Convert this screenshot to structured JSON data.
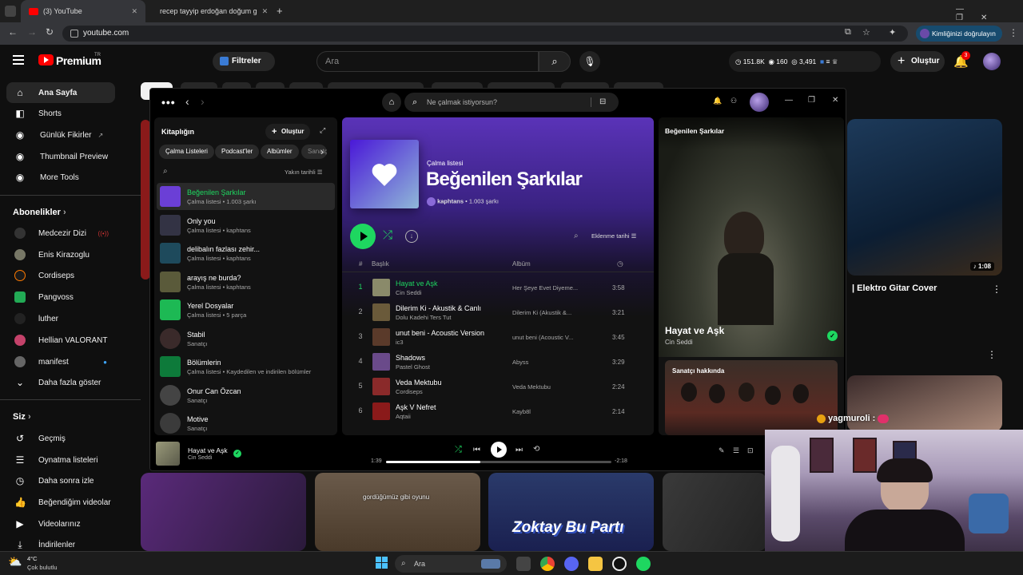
{
  "browser": {
    "tabs": [
      {
        "title": "(3) YouTube",
        "close": "✕"
      },
      {
        "title": "recep tayyip erdoğan doğum g",
        "close": "✕"
      }
    ],
    "new_tab": "+",
    "url": "youtube.com",
    "profile_pill": "Kimliğinizi doğrulayın",
    "window_controls": [
      "—",
      "❐",
      "✕"
    ]
  },
  "youtube": {
    "logo": "Premium",
    "region": "TR",
    "filters_label": "Filtreler",
    "search_placeholder": "Ara",
    "stats": [
      "151.8K",
      "160",
      "3,491"
    ],
    "create_label": "Oluştur",
    "notif_count": "3",
    "sidebar": {
      "main": [
        "Ana Sayfa",
        "Shorts",
        "Günlük Fikirler",
        "Thumbnail Preview",
        "More Tools"
      ],
      "subs_title": "Abonelikler",
      "subs": [
        "Medcezir Dizi",
        "Enis Kirazoglu",
        "Cordiseps",
        "Pangvoss",
        "luther",
        "Hellian VALORANT",
        "manifest"
      ],
      "more": "Daha fazla göster",
      "you_title": "Siz",
      "you": [
        "Geçmiş",
        "Oynatma listeleri",
        "Daha sonra izle",
        "Beğendiğim videolar",
        "Videolarınız",
        "İndirilenler"
      ]
    },
    "feed": {
      "video_title": "| Elektro Gitar Cover",
      "duration": "1:08",
      "subtitle_text": "gordüğümüz gibi oyunu",
      "thumb_text": "Zoktay Bu Partı"
    }
  },
  "spotify": {
    "search_placeholder": "Ne çalmak istiyorsun?",
    "library": {
      "title": "Kitaplığın",
      "create": "Oluştur",
      "chips": [
        "Çalma Listeleri",
        "Podcast'ler",
        "Albümler",
        "Sanatçılar"
      ],
      "sort": "Yakın tarihli",
      "items": [
        {
          "title": "Beğenilen Şarkılar",
          "sub": "Çalma listesi • 1.003 şarkı",
          "color": "#6b3fd6"
        },
        {
          "title": "Only you",
          "sub": "Çalma listesi • kaphtans",
          "color": "#334"
        },
        {
          "title": "delibalın fazlası zehir...",
          "sub": "Çalma listesi • kaphtans",
          "color": "#1e4a5c"
        },
        {
          "title": "arayış ne burda?",
          "sub": "Çalma listesi • kaphtans",
          "color": "#5a5a3a"
        },
        {
          "title": "Yerel Dosyalar",
          "sub": "Çalma listesi • 5 parça",
          "color": "#1db954"
        },
        {
          "title": "Stabil",
          "sub": "Sanatçı",
          "color": "#3a2a2a"
        },
        {
          "title": "Bölümlerin",
          "sub": "Çalma listesi • Kaydedilen ve indirilen bölümler",
          "color": "#0d7a3a"
        },
        {
          "title": "Onur Can Özcan",
          "sub": "Sanatçı",
          "color": "#444"
        },
        {
          "title": "Motive",
          "sub": "Sanatçı",
          "color": "#3b3b3b"
        }
      ]
    },
    "playlist": {
      "type": "Çalma listesi",
      "title": "Beğenilen Şarkılar",
      "owner": "kaphtans",
      "count": "1.003 şarkı",
      "sort": "Eklenme tarihi",
      "col_num": "#",
      "col_title": "Başlık",
      "col_album": "Albüm",
      "tracks": [
        {
          "n": "1",
          "title": "Hayat ve Aşk",
          "artist": "Cin Seddi",
          "album": "Her Şeye Evet Diyeme...",
          "dur": "3:58",
          "color": "#8a8a6a"
        },
        {
          "n": "2",
          "title": "Dilerim Ki - Akustik & Canlı",
          "artist": "Dolu Kadehi Ters Tut",
          "album": "Dilerim Ki (Akustik &...",
          "dur": "3:21",
          "color": "#6a5a3a"
        },
        {
          "n": "3",
          "title": "unut beni - Acoustic Version",
          "artist": "ic3",
          "album": "unut beni (Acoustic V...",
          "dur": "3:45",
          "color": "#5a3a2a"
        },
        {
          "n": "4",
          "title": "Shadows",
          "artist": "Pastel Ghost",
          "album": "Abyss",
          "dur": "3:29",
          "color": "#6a4a8a"
        },
        {
          "n": "5",
          "title": "Veda Mektubu",
          "artist": "Cordiseps",
          "album": "Veda Mektubu",
          "dur": "2:24",
          "color": "#8a2a2a"
        },
        {
          "n": "6",
          "title": "Aşk V Nefret",
          "artist": "Aqtaii",
          "album": "Kayb8l",
          "dur": "2:14",
          "color": "#8a1a1a"
        }
      ]
    },
    "now_playing_panel": {
      "title": "Beğenilen Şarkılar",
      "song": "Hayat ve Aşk",
      "artist": "Cin Seddi",
      "about": "Sanatçı hakkında"
    },
    "player": {
      "song": "Hayat ve Aşk",
      "artist": "Cin Seddi",
      "elapsed": "1:39",
      "remaining": "-2:18",
      "progress": 0.42
    }
  },
  "stream": {
    "chat_user": "yagmuroli :"
  },
  "taskbar": {
    "weather_temp": "4°C",
    "weather_desc": "Çok bulutlu",
    "search": "Ara"
  }
}
